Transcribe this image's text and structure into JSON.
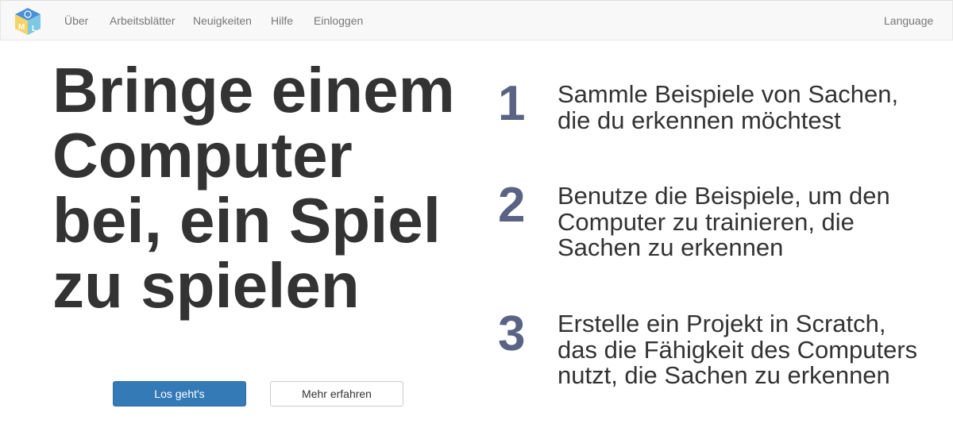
{
  "nav": {
    "items": [
      "Über",
      "Arbeitsblätter",
      "Neuigkeiten",
      "Hilfe",
      "Einloggen"
    ],
    "language_label": "Language",
    "logo_letters": {
      "m": "M",
      "l": "L"
    }
  },
  "hero": {
    "headline": "Bringe einem Computer bei, ein Spiel zu spielen",
    "primary_button": "Los geht's",
    "secondary_button": "Mehr erfahren"
  },
  "steps": [
    {
      "number": "1",
      "text": "Sammle Beispiele von Sachen, die du erkennen möchtest"
    },
    {
      "number": "2",
      "text": "Benutze die Beispiele, um den Computer zu trainieren, die Sachen zu erkennen"
    },
    {
      "number": "3",
      "text": "Erstelle ein Projekt in Scratch, das die Fähigkeit des Computers nutzt, die Sachen zu erkennen"
    }
  ],
  "colors": {
    "primary": "#337ab7",
    "step_number": "#5b6384",
    "navbar_bg": "#f8f8f8",
    "nav_text": "#777777"
  }
}
